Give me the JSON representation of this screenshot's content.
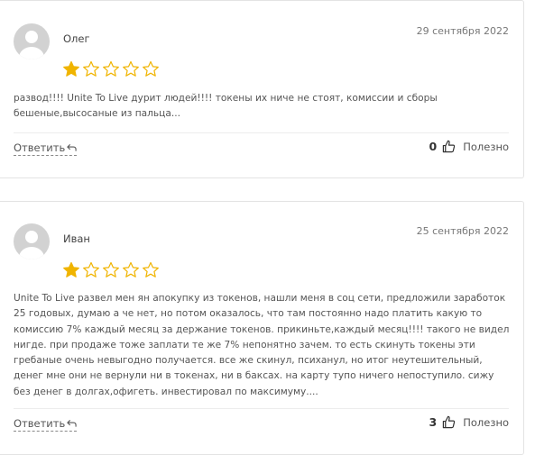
{
  "colors": {
    "star": "#f0b400",
    "star_empty_stroke": "#f0b400",
    "text": "#555555",
    "border": "#e3e3e3"
  },
  "reviews": [
    {
      "author": "Олег",
      "date": "29 сентября 2022",
      "rating": 1,
      "max_rating": 5,
      "text": "развод!!!! Unite To Live дурит людей!!!! токены их ниче не стоят, комиссии и сборы бешеные,высосаные из пальца...",
      "reply_label": "Ответить",
      "votes": "0",
      "useful_label": "Полезно"
    },
    {
      "author": "Иван",
      "date": "25 сентября 2022",
      "rating": 1,
      "max_rating": 5,
      "text": "Unite To Live развел мен ян апокупку из токенов, нашли меня в соц сети, предложили заработок 25 годовых, думаю а че нет, но потом оказалось, что там постоянно надо платить какую то комиссию 7% каждый месяц за держание токенов. прикиньте,каждый месяц!!!! такого не видел нигде. при продаже тоже заплати те же 7% непонятно зачем. то есть скинуть токены эти гребаные очень невыгодно получается. все же скинул, психанул, но итог неутешительный, денег мне они не вернули ни в токенах, ни в баксах. на карту тупо ничего непоступило. сижу без денег в долгах,офигеть. инвестировал по максимуму....",
      "reply_label": "Ответить",
      "votes": "3",
      "useful_label": "Полезно"
    }
  ]
}
